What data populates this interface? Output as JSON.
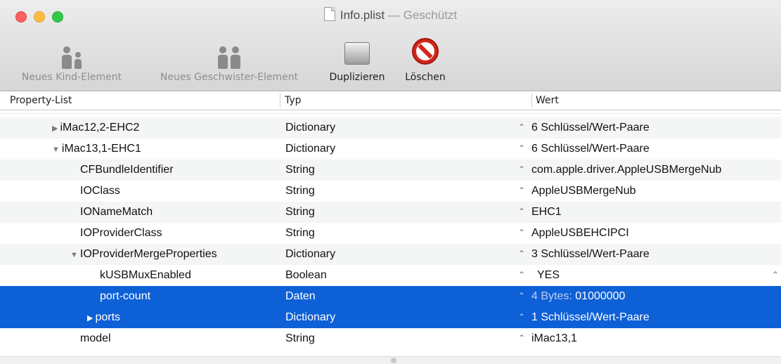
{
  "window": {
    "title": "Info.plist",
    "separator": " — ",
    "status": "Geschützt"
  },
  "toolbar": {
    "new_child_label": "Neues Kind-Element",
    "new_sibling_label": "Neues Geschwister-Element",
    "duplicate_label": "Duplizieren",
    "delete_label": "Löschen"
  },
  "table": {
    "columns": [
      "Property-List",
      "Typ",
      "Wert"
    ],
    "rows": [
      {
        "key": "iMac12,2-EHC2",
        "type": "Dictionary",
        "value": "6 Schlüssel/Wert-Paare",
        "disclosure": "▶"
      },
      {
        "key": "iMac13,1-EHC1",
        "type": "Dictionary",
        "value": "6 Schlüssel/Wert-Paare",
        "disclosure": "▼"
      },
      {
        "key": "CFBundleIdentifier",
        "type": "String",
        "value": "com.apple.driver.AppleUSBMergeNub"
      },
      {
        "key": "IOClass",
        "type": "String",
        "value": "AppleUSBMergeNub"
      },
      {
        "key": "IONameMatch",
        "type": "String",
        "value": "EHC1"
      },
      {
        "key": "IOProviderClass",
        "type": "String",
        "value": "AppleUSBEHCIPCI"
      },
      {
        "key": "IOProviderMergeProperties",
        "type": "Dictionary",
        "value": "3 Schlüssel/Wert-Paare",
        "disclosure": "▼"
      },
      {
        "key": "kUSBMuxEnabled",
        "type": "Boolean",
        "value": "YES"
      },
      {
        "key": "port-count",
        "type": "Daten",
        "value_prefix": "4 Bytes:",
        "value": "01000000"
      },
      {
        "key": "ports",
        "type": "Dictionary",
        "value": "1 Schlüssel/Wert-Paare",
        "disclosure": "▶"
      },
      {
        "key": "model",
        "type": "String",
        "value": "iMac13,1"
      }
    ]
  },
  "colors": {
    "selection": "#0e60d6",
    "close": "#fc605c",
    "minimize": "#fdbc40",
    "zoom": "#34c84a"
  },
  "icons": {
    "stepper": "⌃⌄",
    "up_down": "⇕"
  }
}
